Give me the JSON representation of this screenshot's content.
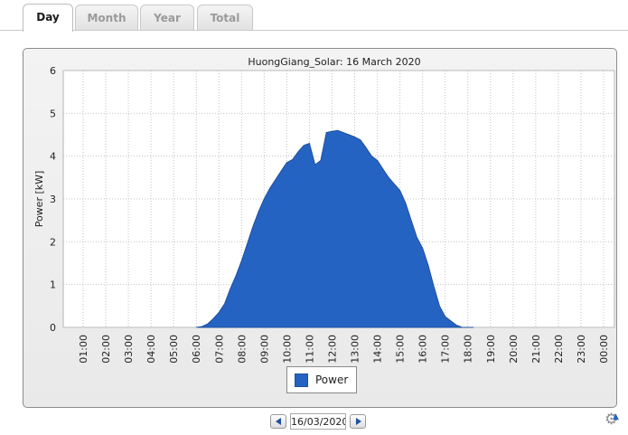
{
  "tabs": [
    {
      "label": "Day",
      "active": true
    },
    {
      "label": "Month",
      "active": false
    },
    {
      "label": "Year",
      "active": false
    },
    {
      "label": "Total",
      "active": false
    }
  ],
  "date_nav": {
    "date": "16/03/2020"
  },
  "colors": {
    "series": "#2563c3",
    "series_edge": "#1f4f9c"
  },
  "icons": {
    "prev": "triangle-left-icon",
    "next": "triangle-right-icon",
    "settings": "gear-icon"
  },
  "chart_data": {
    "type": "area",
    "title": "HuongGiang_Solar: 16 March 2020",
    "ylabel": "Power [kW]",
    "xlabel": "",
    "ylim": [
      0,
      6
    ],
    "yticks": [
      0,
      1,
      2,
      3,
      4,
      5,
      6
    ],
    "xticks": [
      "01:00",
      "02:00",
      "03:00",
      "04:00",
      "05:00",
      "06:00",
      "07:00",
      "08:00",
      "09:00",
      "10:00",
      "11:00",
      "12:00",
      "13:00",
      "14:00",
      "15:00",
      "16:00",
      "17:00",
      "18:00",
      "19:00",
      "20:00",
      "21:00",
      "22:00",
      "23:00",
      "00:00"
    ],
    "grid": true,
    "legend_position": "bottom",
    "series": [
      {
        "name": "Power",
        "x": [
          "06:00",
          "06:15",
          "06:30",
          "06:45",
          "07:00",
          "07:15",
          "07:30",
          "07:45",
          "08:00",
          "08:15",
          "08:30",
          "08:45",
          "09:00",
          "09:15",
          "09:30",
          "09:45",
          "10:00",
          "10:15",
          "10:30",
          "10:45",
          "11:00",
          "11:15",
          "11:30",
          "11:45",
          "12:00",
          "12:15",
          "12:30",
          "12:45",
          "13:00",
          "13:15",
          "13:30",
          "13:45",
          "14:00",
          "14:15",
          "14:30",
          "14:45",
          "15:00",
          "15:15",
          "15:30",
          "15:45",
          "16:00",
          "16:15",
          "16:30",
          "16:45",
          "17:00",
          "17:15",
          "17:30",
          "17:45",
          "18:00",
          "18:15"
        ],
        "values": [
          0,
          0.02,
          0.08,
          0.2,
          0.35,
          0.55,
          0.9,
          1.2,
          1.55,
          1.95,
          2.35,
          2.7,
          3.0,
          3.25,
          3.45,
          3.65,
          3.85,
          3.92,
          4.1,
          4.25,
          4.3,
          3.8,
          3.9,
          4.55,
          4.58,
          4.6,
          4.55,
          4.5,
          4.45,
          4.38,
          4.2,
          4.0,
          3.9,
          3.7,
          3.5,
          3.35,
          3.2,
          2.9,
          2.5,
          2.1,
          1.85,
          1.45,
          0.95,
          0.5,
          0.25,
          0.15,
          0.05,
          0,
          0,
          0
        ]
      }
    ]
  }
}
